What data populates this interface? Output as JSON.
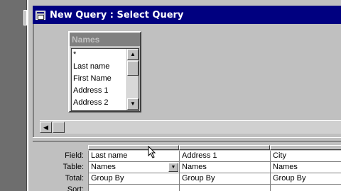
{
  "window": {
    "title": "New Query : Select Query"
  },
  "field_list": {
    "title": "Names",
    "items": [
      "*",
      "Last name",
      "First Name",
      "Address 1",
      "Address 2"
    ]
  },
  "grid": {
    "row_labels": [
      "Field:",
      "Table:",
      "Total:",
      "Sort:"
    ],
    "columns": [
      {
        "field": "Last name",
        "table": "Names",
        "total": "Group By"
      },
      {
        "field": "Address 1",
        "table": "Names",
        "total": "Group By"
      },
      {
        "field": "City",
        "table": "Names",
        "total": "Group By"
      }
    ]
  },
  "colors": {
    "titlebar": "#000080",
    "face": "#c0c0c0",
    "field_list_title": "#808080"
  },
  "icons": [
    "query-window-icon",
    "scroll-up-arrow-icon",
    "scroll-down-arrow-icon",
    "scroll-left-arrow-icon",
    "dropdown-arrow-icon",
    "mouse-pointer-icon"
  ]
}
